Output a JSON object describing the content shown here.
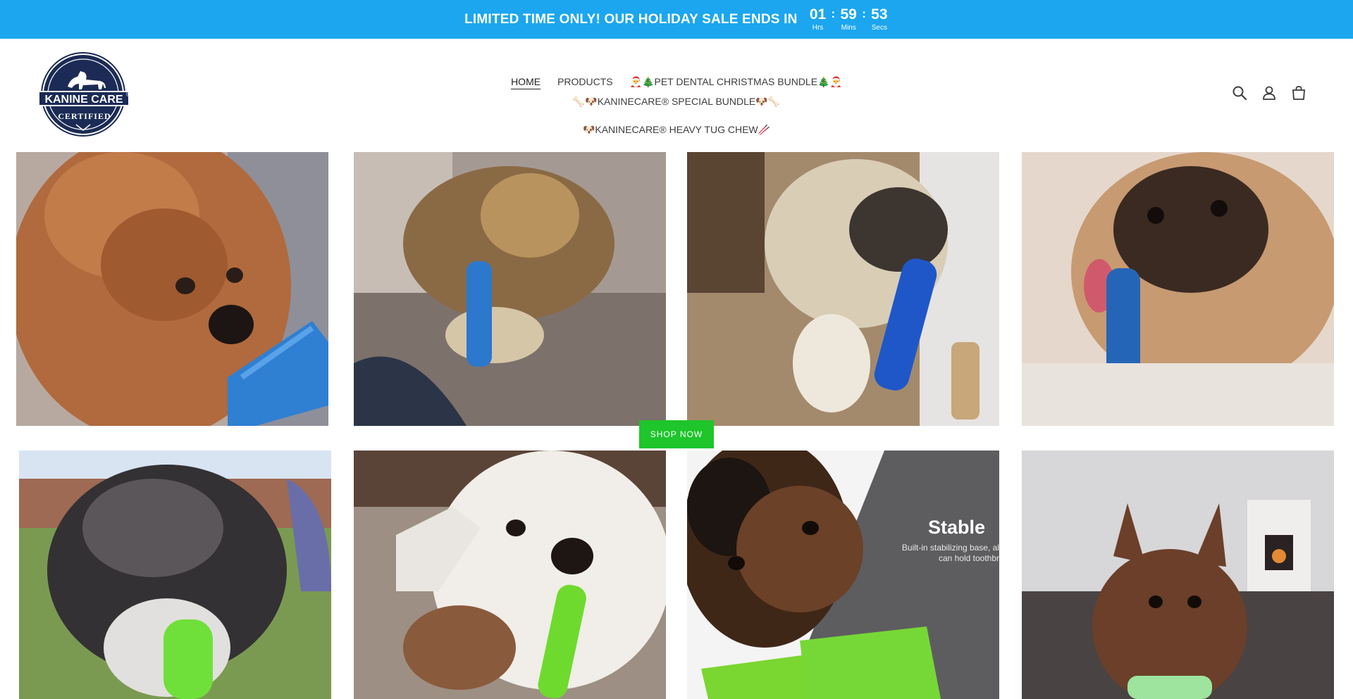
{
  "announcement": {
    "text": "LIMITED TIME ONLY! OUR HOLIDAY SALE ENDS IN",
    "timer": [
      {
        "value": "01",
        "label": "Hrs"
      },
      {
        "value": "59",
        "label": "Mins"
      },
      {
        "value": "53",
        "label": "Secs"
      }
    ],
    "background": "#1ba6ef"
  },
  "logo": {
    "line1": "KANINE CARE",
    "line2": "CERTIFIED",
    "mark": "®"
  },
  "nav": {
    "items": [
      {
        "label": "HOME",
        "active": true
      },
      {
        "label": "PRODUCTS",
        "active": false
      },
      {
        "label": "🎅🎄PET DENTAL CHRISTMAS BUNDLE🎄🎅",
        "active": false
      },
      {
        "label": "🦴🐶KANINECARE® SPECIAL BUNDLE🐶🦴",
        "active": false
      },
      {
        "label": "🐶KANINECARE® HEAVY TUG CHEW🥢",
        "active": false
      }
    ]
  },
  "header_icons": [
    "search-icon",
    "account-icon",
    "cart-icon"
  ],
  "gallery": {
    "shop_button": "SHOP NOW",
    "overlay_title": "Stable",
    "overlay_sub": "Built-in stabilizing base, al\ncan hold toothbr",
    "button_color": "#1ec52b"
  }
}
